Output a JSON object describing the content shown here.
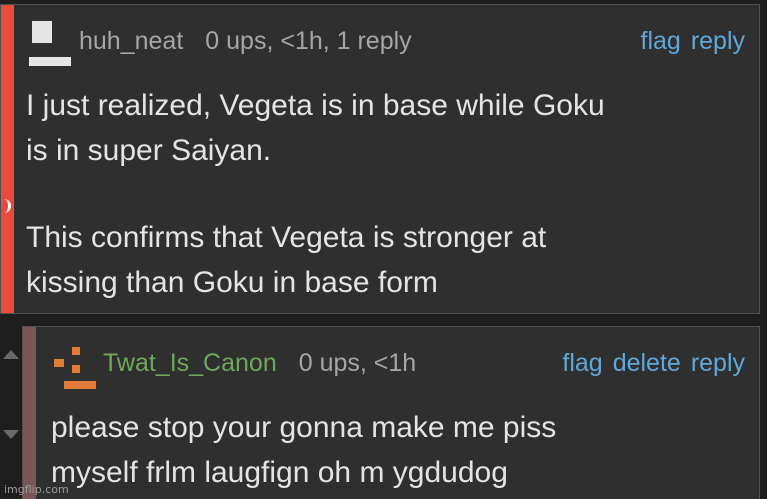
{
  "comments": [
    {
      "username": "huh_neat",
      "info": "0 ups, <1h, 1 reply",
      "actions": [
        "flag",
        "reply"
      ],
      "body_lines": [
        "I just realized, Vegeta is in base while Goku",
        "is in super Saiyan.",
        "This confirms that Vegeta is stronger at",
        "kissing than Goku in base form"
      ],
      "bar_color": "#e84a3c"
    },
    {
      "username": "Twat_Is_Canon",
      "info": "0 ups, <1h",
      "actions": [
        "flag",
        "delete",
        "reply"
      ],
      "body_lines": [
        "please stop your gonna make me piss",
        "myself frlm laugfign oh m ygdudog"
      ],
      "bar_color": "#7a5555",
      "username_color": "#6fa85a"
    }
  ],
  "colors": {
    "link": "#5fa8d9",
    "meta": "#a6a6a6",
    "text": "#e4e4e4",
    "avatar_accent": "#e07b39"
  },
  "icons": {
    "vote_up": "upvote-arrow-icon",
    "vote_down": "downvote-arrow-icon"
  },
  "watermark": "imgflip.com"
}
